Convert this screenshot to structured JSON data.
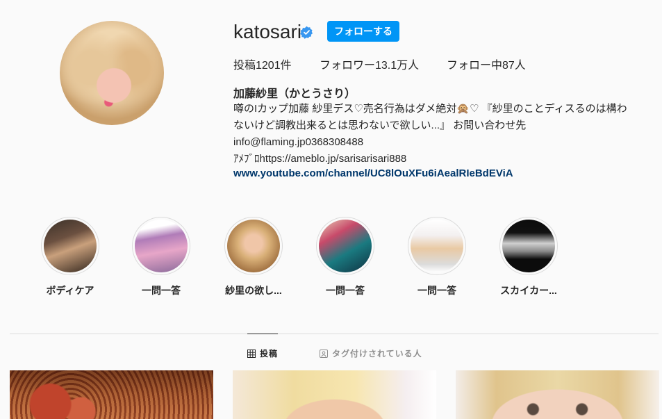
{
  "profile": {
    "username": "katosari",
    "follow_label": "フォローする",
    "stats": {
      "posts": "投稿1201件",
      "followers": "フォロワー13.1万人",
      "following": "フォロー中87人"
    },
    "full_name": "加藤紗里（かとうさり）",
    "bio_lines": [
      "噂のIカップ加藤 紗里デス♡売名行為はダメ絶対🙊♡ 『紗里のことディスるのは構わ",
      "ないけど調教出来るとは思わないで欲しい...』 お問い合わせ先",
      "info@flaming.jp0368308488",
      "ｱﾒﾌﾞﾛhttps://ameblo.jp/sarisarisari888"
    ],
    "link": "www.youtube.com/channel/UC8lOuXFu6iAealRIeBdEViA"
  },
  "highlights": [
    {
      "label": "ボディケア"
    },
    {
      "label": "一問一答"
    },
    {
      "label": "紗里の欲し..."
    },
    {
      "label": "一問一答"
    },
    {
      "label": "一問一答"
    },
    {
      "label": "スカイカー..."
    }
  ],
  "tabs": {
    "posts": "投稿",
    "tagged": "タグ付けされている人"
  },
  "colors": {
    "follow_button": "#0095f6",
    "verified_badge": "#3897f0",
    "link": "#00376b",
    "background": "#fafafa"
  },
  "icons": [
    "verified-badge-icon",
    "grid-icon",
    "tagged-icon"
  ]
}
